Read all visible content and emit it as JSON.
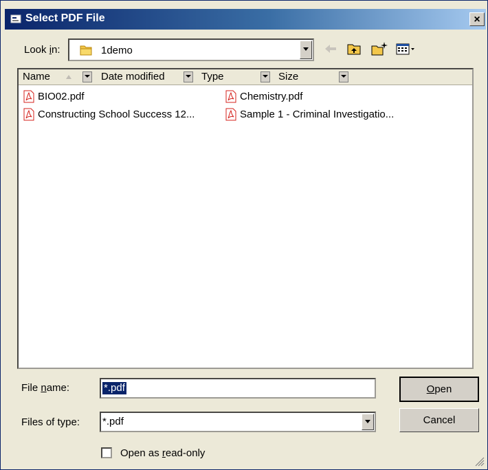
{
  "window": {
    "title": "Select PDF File",
    "close_label": "×"
  },
  "lookin": {
    "label_pre": "Look ",
    "label_u": "i",
    "label_post": "n:",
    "value": "1demo"
  },
  "toolbar": {
    "icons": [
      "back-arrow-icon",
      "up-folder-icon",
      "new-folder-icon",
      "view-menu-icon"
    ]
  },
  "columns": [
    {
      "name": "Name"
    },
    {
      "name": "Date modified"
    },
    {
      "name": "Type"
    },
    {
      "name": "Size"
    }
  ],
  "files": [
    {
      "name": "BIO02.pdf"
    },
    {
      "name": "Chemistry.pdf"
    },
    {
      "name": "Constructing School Success 12..."
    },
    {
      "name": "Sample 1 - Criminal Investigatio..."
    }
  ],
  "filename": {
    "label_pre": "File ",
    "label_u": "n",
    "label_post": "ame:",
    "value": "*.pdf"
  },
  "filetype": {
    "label": "Files of type:",
    "value": "*.pdf"
  },
  "buttons": {
    "open_u": "O",
    "open_rest": "pen",
    "cancel": "Cancel"
  },
  "readonly": {
    "label_pre": "Open as ",
    "label_u": "r",
    "label_post": "ead-only"
  },
  "colors": {
    "title_start": "#0a246a",
    "title_end": "#a6caf0",
    "selection": "#0a246a",
    "pdf_red": "#d4201b"
  }
}
